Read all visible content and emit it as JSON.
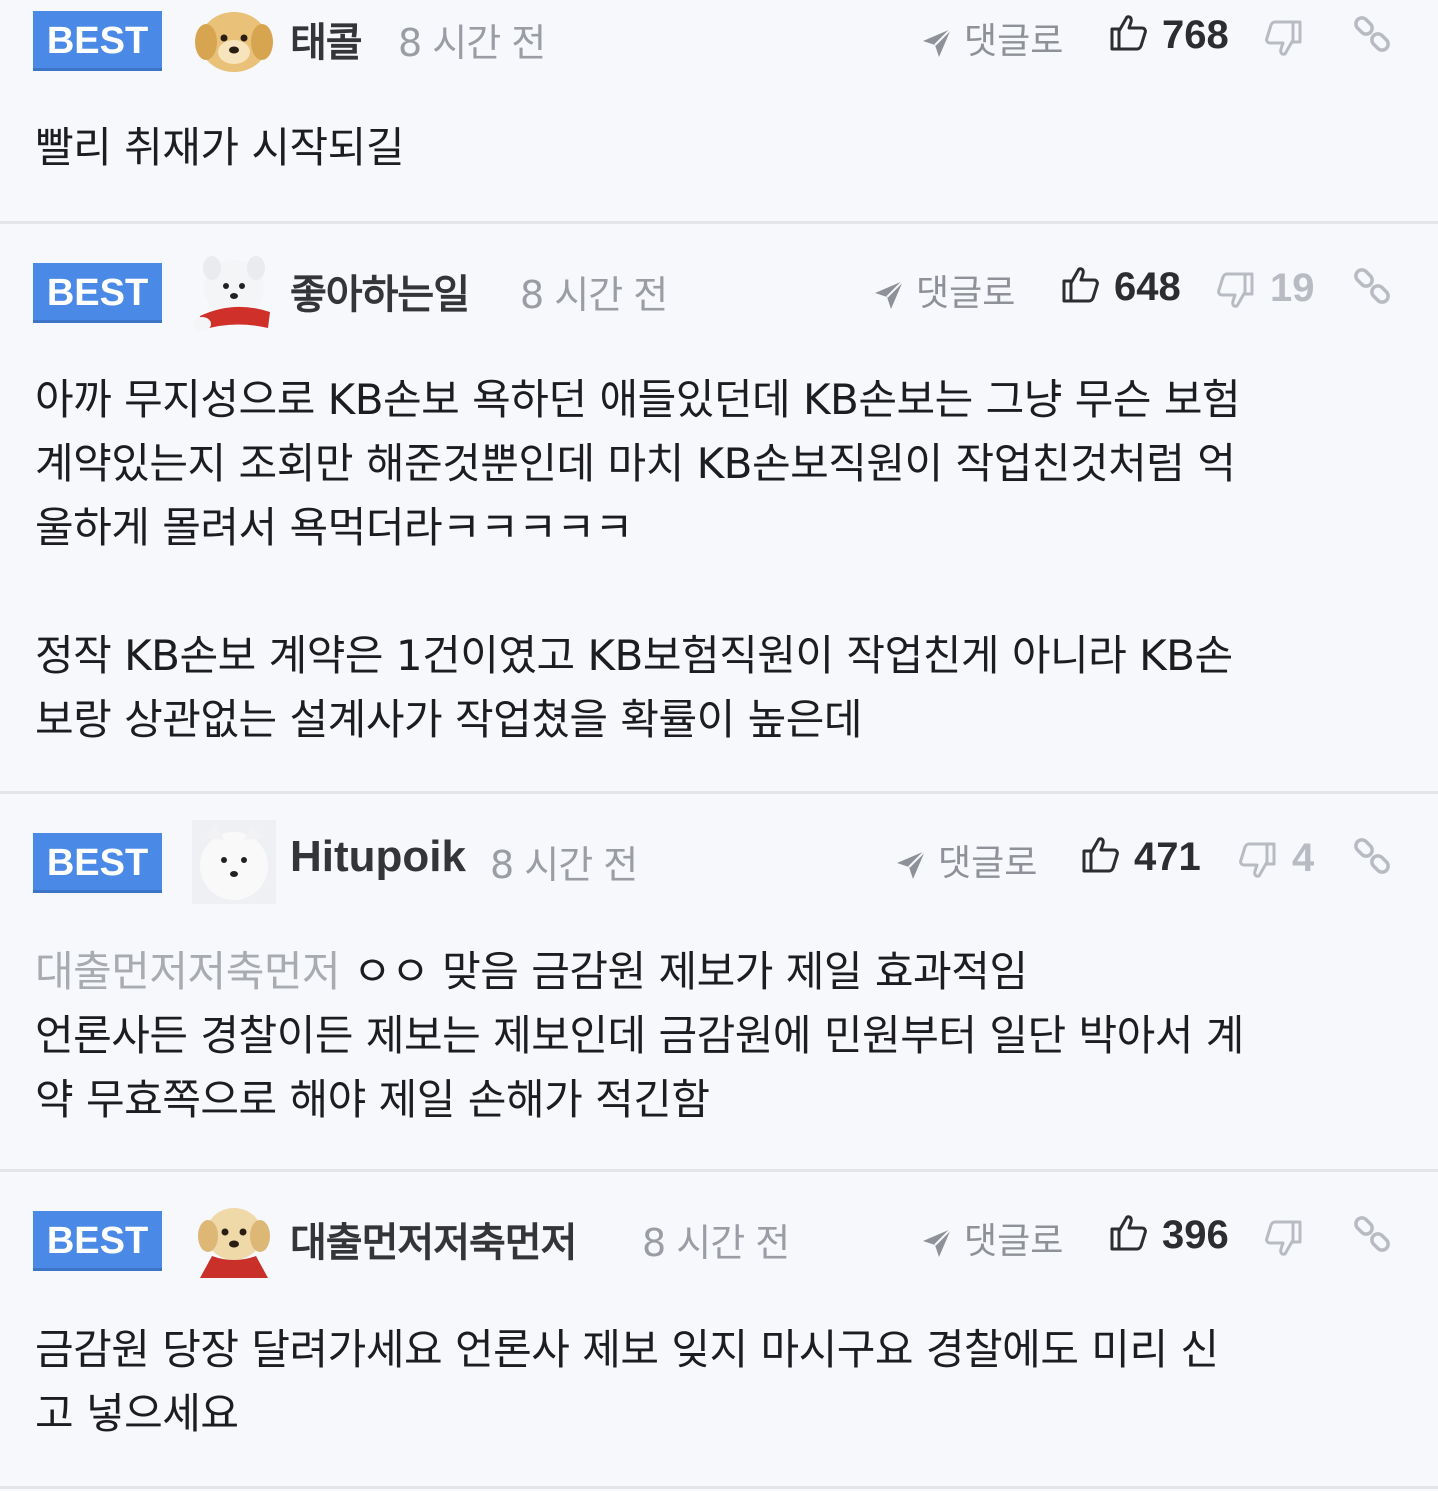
{
  "labels": {
    "best": "BEST",
    "reply": "댓글로"
  },
  "colors": {
    "best_badge": "#4a8ae6",
    "background": "#f6f8fc",
    "divider": "#e3e5e9",
    "muted_text": "#9a9da3"
  },
  "comments": [
    {
      "nickname": "태콜",
      "time": "8 시간 전",
      "likes": "768",
      "dislikes": "",
      "avatar": "puppy-avatar",
      "lines": [
        "빨리 취재가 시작되길"
      ]
    },
    {
      "nickname": "좋아하는일",
      "time": "8 시간 전",
      "likes": "648",
      "dislikes": "19",
      "avatar": "white-dog-avatar",
      "lines": [
        "아까 무지성으로 KB손보 욕하던 애들있던데 KB손보는 그냥 무슨 보험",
        "계약있는지 조회만 해준것뿐인데 마치 KB손보직원이 작업친것처럼 억",
        "울하게 몰려서 욕먹더라ㅋㅋㅋㅋㅋ",
        "",
        "정작 KB손보 계약은 1건이였고 KB보험직원이 작업친게 아니라 KB손",
        "보랑 상관없는 설계사가 작업쳤을 확률이 높은데"
      ]
    },
    {
      "nickname": "Hitupoik",
      "time": "8 시간 전",
      "likes": "471",
      "dislikes": "4",
      "avatar": "samoyed-avatar",
      "quote_ref": "대출먼저저축먼저",
      "lines": [
        "ㅇㅇ 맞음 금감원 제보가 제일 효과적임",
        "언론사든 경찰이든 제보는 제보인데 금감원에 민원부터 일단 박아서 계",
        "약 무효쪽으로 해야 제일 손해가 적긴함"
      ]
    },
    {
      "nickname": "대출먼저저축먼저",
      "time": "8 시간 전",
      "likes": "396",
      "dislikes": "",
      "avatar": "retriever-avatar",
      "lines": [
        "금감원 당장 달려가세요 언론사 제보 잊지 마시구요 경찰에도 미리 신",
        "고 넣으세요"
      ]
    }
  ]
}
